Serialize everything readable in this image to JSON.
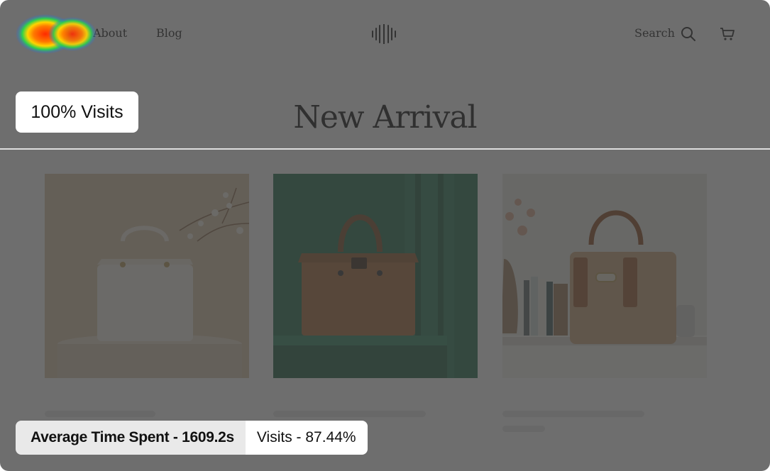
{
  "nav": {
    "links": [
      "About",
      "Blog"
    ],
    "search_label": "Search",
    "logo_icon": "soundwave-logo-icon",
    "search_icon": "search-icon",
    "cart_icon": "cart-icon"
  },
  "main": {
    "title": "New Arrival",
    "products": [
      {
        "image": "white handbag on round pedestal",
        "icon": "handbag-image"
      },
      {
        "image": "brown handbag on green pedestal",
        "icon": "handbag-image"
      },
      {
        "image": "tan handbag on shelf with books",
        "icon": "handbag-image"
      }
    ]
  },
  "heatmap": {
    "click_visits_label": "100% Visits",
    "avg_time_label": "Average Time Spent - 1609.2s",
    "visits_label": "Visits - 87.44%",
    "overlay_color": "#3c3c3c",
    "heat_colors": [
      "#ff2a00",
      "#ffd400",
      "#2fd14a",
      "#2a5cff"
    ]
  }
}
